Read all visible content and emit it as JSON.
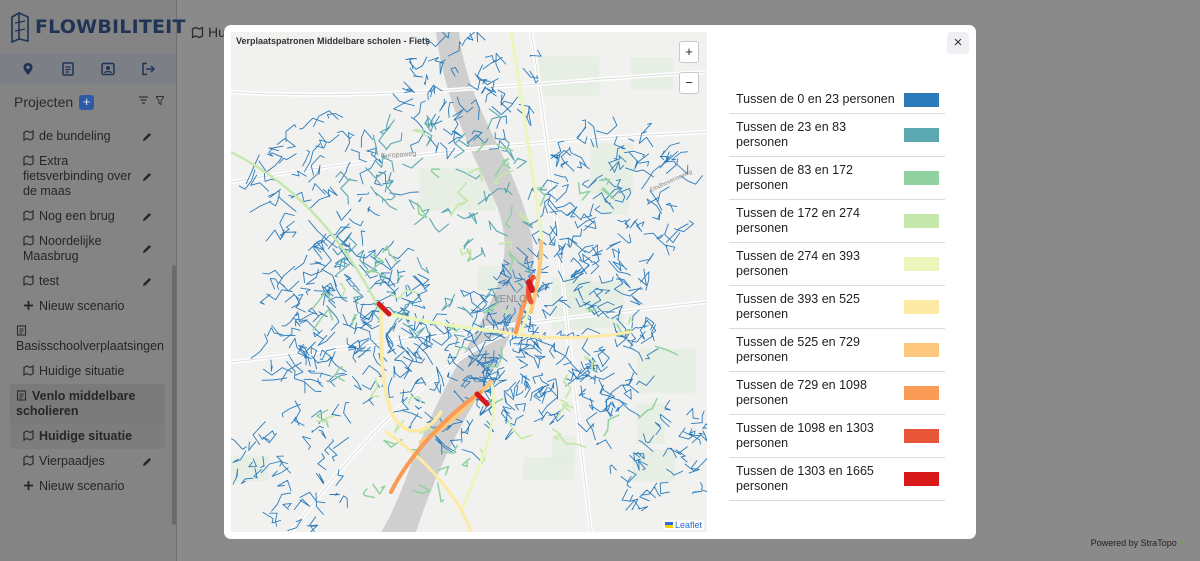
{
  "app": {
    "logo_text": "FLOWBILITEIT",
    "crumb_text": "Hu",
    "powered_by": "Powered by StraTopo"
  },
  "sidebar": {
    "projects_title": "Projecten",
    "items": [
      {
        "label": "de bundeling",
        "kind": "scenario",
        "editable": true
      },
      {
        "label": "Extra fietsverbinding over de maas",
        "kind": "scenario",
        "editable": true
      },
      {
        "label": "Nog een brug",
        "kind": "scenario",
        "editable": true
      },
      {
        "label": "Noordelijke Maasbrug",
        "kind": "scenario",
        "editable": true
      },
      {
        "label": "test",
        "kind": "scenario",
        "editable": true
      },
      {
        "label": "Nieuw scenario",
        "kind": "new",
        "editable": false
      },
      {
        "label": "Basisschoolverplaatsingen",
        "kind": "project",
        "editable": false
      },
      {
        "label": "Huidige situatie",
        "kind": "scenario",
        "editable": false
      },
      {
        "label": "Venlo middelbare scholieren",
        "kind": "project-active",
        "editable": false
      },
      {
        "label": "Huidige situatie",
        "kind": "scenario-selected",
        "editable": false
      },
      {
        "label": "Vierpaadjes",
        "kind": "scenario",
        "editable": true
      },
      {
        "label": "Nieuw scenario",
        "kind": "new",
        "editable": false
      }
    ]
  },
  "modal": {
    "map_title": "Verplaatspatronen Middelbare scholen - Fiets",
    "zoom_in": "+",
    "zoom_out": "−",
    "attribution": "Leaflet",
    "close": "×",
    "map_labels": {
      "road1": "Europaweg",
      "road2": "Eindhovenseweg",
      "city": "VENLO"
    }
  },
  "legend": [
    {
      "label": "Tussen de 0 en 23 personen",
      "color": "#2b7bba"
    },
    {
      "label": "Tussen de 23 en 83 personen",
      "color": "#5ba8b0"
    },
    {
      "label": "Tussen de 83 en 172 personen",
      "color": "#92d2a0"
    },
    {
      "label": "Tussen de 172 en 274 personen",
      "color": "#c7e8ad"
    },
    {
      "label": "Tussen de 274 en 393 personen",
      "color": "#ebf6bc"
    },
    {
      "label": "Tussen de 393 en 525 personen",
      "color": "#fdeaa4"
    },
    {
      "label": "Tussen de 525 en 729 personen",
      "color": "#fdc77e"
    },
    {
      "label": "Tussen de 729 en 1098 personen",
      "color": "#f99a57"
    },
    {
      "label": "Tussen de 1098 en 1303 personen",
      "color": "#e8563a"
    },
    {
      "label": "Tussen de 1303 en 1665 personen",
      "color": "#d7191c"
    }
  ]
}
